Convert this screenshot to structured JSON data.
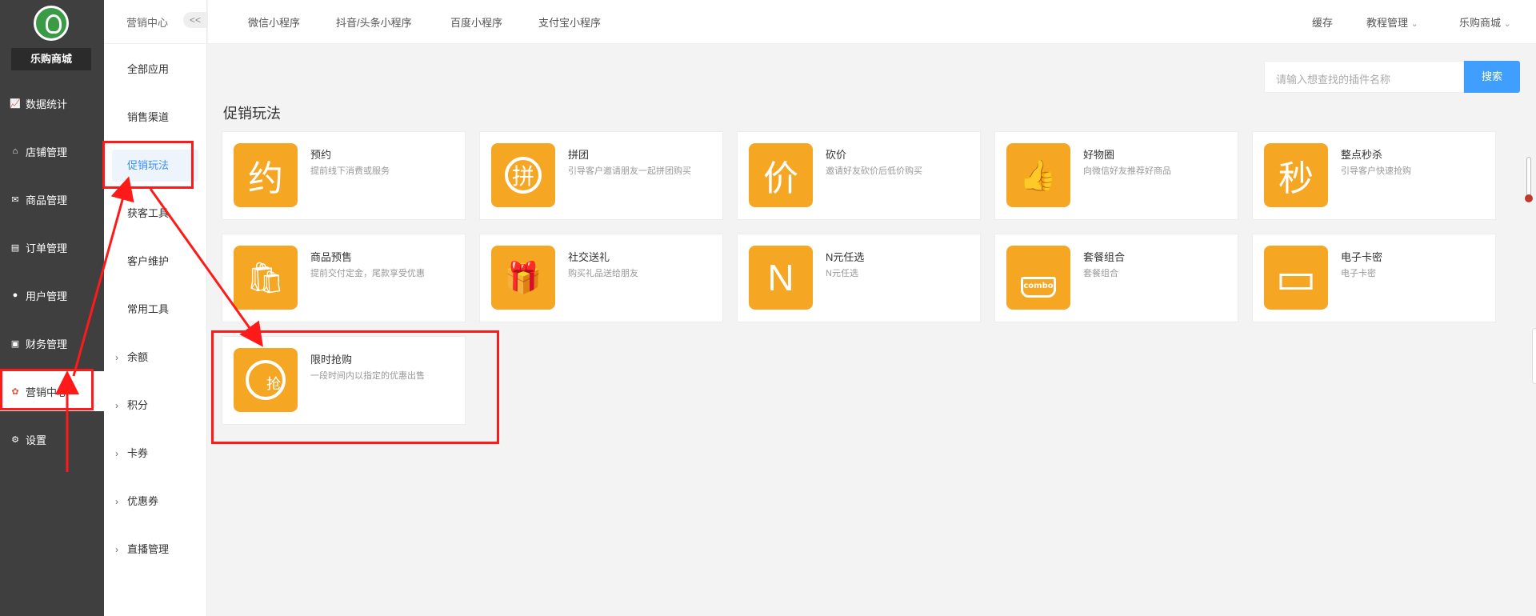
{
  "sidebar": {
    "shop_name": "乐购商城",
    "items": [
      {
        "label": "数据统计",
        "icon": "chart-icon"
      },
      {
        "label": "店铺管理",
        "icon": "store-icon"
      },
      {
        "label": "商品管理",
        "icon": "goods-icon"
      },
      {
        "label": "订单管理",
        "icon": "order-icon"
      },
      {
        "label": "用户管理",
        "icon": "user-icon"
      },
      {
        "label": "财务管理",
        "icon": "finance-icon"
      },
      {
        "label": "营销中心",
        "icon": "marketing-icon"
      },
      {
        "label": "设置",
        "icon": "gear-icon"
      }
    ],
    "active": "营销中心"
  },
  "subnav": {
    "title": "营销中心",
    "collapse_label": "<<",
    "items": [
      {
        "label": "全部应用"
      },
      {
        "label": "销售渠道"
      },
      {
        "label": "促销玩法"
      },
      {
        "label": "获客工具"
      },
      {
        "label": "客户维护"
      },
      {
        "label": "常用工具"
      },
      {
        "label": "余额"
      },
      {
        "label": "积分"
      },
      {
        "label": "卡券"
      },
      {
        "label": "优惠券"
      },
      {
        "label": "直播管理"
      }
    ],
    "selected": "促销玩法"
  },
  "topbar": {
    "tabs": [
      "微信小程序",
      "抖音/头条小程序",
      "百度小程序",
      "支付宝小程序"
    ],
    "cache": "缓存",
    "tutorial": "教程管理",
    "store": "乐购商城"
  },
  "search": {
    "placeholder": "请输入想查找的插件名称",
    "button": "搜索"
  },
  "section": {
    "title": "促销玩法"
  },
  "cards": [
    {
      "name": "预约",
      "desc": "提前线下消费或服务",
      "glyph": "约"
    },
    {
      "name": "拼团",
      "desc": "引导客户邀请朋友一起拼团购买",
      "glyph": "拼"
    },
    {
      "name": "砍价",
      "desc": "邀请好友砍价后低价购买",
      "glyph": "价"
    },
    {
      "name": "好物圈",
      "desc": "向微信好友推荐好商品",
      "glyph": "👍"
    },
    {
      "name": "整点秒杀",
      "desc": "引导客户快速抢购",
      "glyph": "秒"
    },
    {
      "name": "商品预售",
      "desc": "提前交付定金，尾款享受优惠",
      "glyph": "🛍"
    },
    {
      "name": "社交送礼",
      "desc": "购买礼品送给朋友",
      "glyph": "🎁"
    },
    {
      "name": "N元任选",
      "desc": "N元任选",
      "glyph": "N"
    },
    {
      "name": "套餐组合",
      "desc": "套餐组合",
      "glyph": "combo"
    },
    {
      "name": "电子卡密",
      "desc": "电子卡密",
      "glyph": "▭"
    },
    {
      "name": "限时抢购",
      "desc": "一段时间内以指定的优惠出售",
      "glyph": "抢"
    }
  ],
  "colors": {
    "sidebar_bg": "#3f3f3f",
    "accent": "#409eff",
    "card_icon": "#f5a623",
    "annotation": "#ff1a1a"
  }
}
